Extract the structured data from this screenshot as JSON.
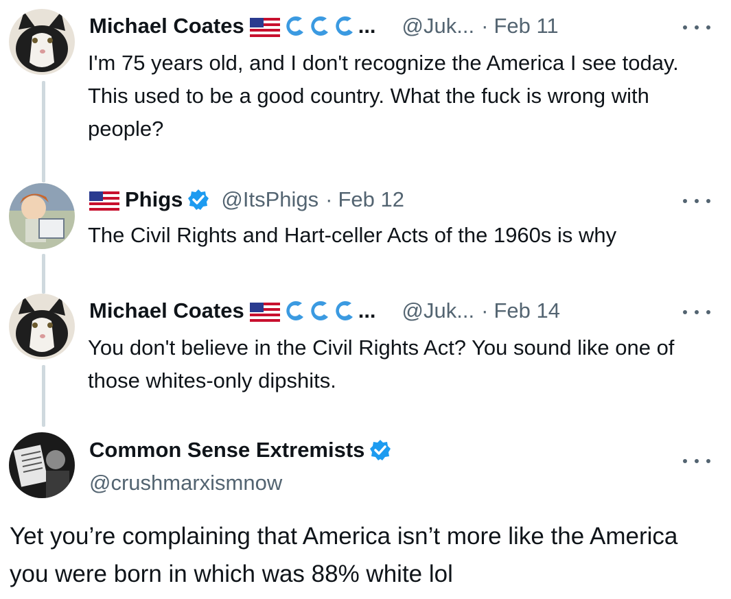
{
  "tweets": [
    {
      "name": "Michael Coates",
      "badges": [
        "us-flag-icon",
        "wave-icon",
        "wave-icon",
        "wave-icon"
      ],
      "name_ellipsis": "...",
      "handle": "@Juk...",
      "separator": "·",
      "date": "Feb 11",
      "text": "I'm 75 years old, and I don't recognize the America I see today. This used to be a good country. What the fuck is wrong with people?"
    },
    {
      "flag_before_name": "us-flag-icon",
      "name": "Phigs",
      "verified": true,
      "handle": "@ItsPhigs",
      "separator": "·",
      "date": "Feb 12",
      "text": "The Civil Rights and Hart-celler Acts of the 1960s is why"
    },
    {
      "name": "Michael Coates",
      "badges": [
        "us-flag-icon",
        "wave-icon",
        "wave-icon",
        "wave-icon"
      ],
      "name_ellipsis": "...",
      "handle": "@Juk...",
      "separator": "·",
      "date": "Feb 14",
      "text": "You don't believe in the Civil Rights Act? You sound like one of those whites-only dipshits."
    },
    {
      "name": "Common Sense Extremists",
      "verified": true,
      "handle": "@crushmarxismnow",
      "text": "Yet you’re complaining that America isn’t more like the America you were born in which was 88% white lol"
    }
  ],
  "colors": {
    "text": "#0f1419",
    "secondary": "#536471",
    "verified_blue": "#1d9bf0",
    "wave_blue": "#3b9ae1",
    "thread_line": "#cfd9de"
  }
}
